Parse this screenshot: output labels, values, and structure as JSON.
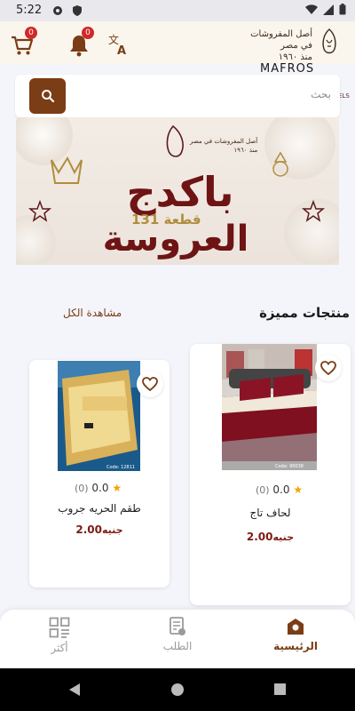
{
  "status_bar": {
    "time": "5:22"
  },
  "header": {
    "cart_badge": "0",
    "notifications_badge": "0",
    "logo_line1": "أصل المفروشات في مصر",
    "logo_line2": "منذ ١٩٦٠",
    "sub_brand": "MAFROS",
    "sub_brand2": "ELS"
  },
  "search": {
    "placeholder": "بحث"
  },
  "banner": {
    "title_line1": "باكدج",
    "title_line2": "العروسة",
    "pieces": "131 قطعة",
    "logo_line1": "أصل المفروشات في مصر",
    "logo_line2": "منذ ١٩٦٠"
  },
  "featured": {
    "title": "منتجات مميزة",
    "see_all": "مشاهدة الكل",
    "products": [
      {
        "name": "لحاف تاج",
        "rating": "0.0",
        "count": "(0)",
        "price": "2.00",
        "currency": "جنيه",
        "image_caption": "Code: 90038"
      },
      {
        "name": "طقم الحريه جروب",
        "rating": "0.0",
        "count": "(0)",
        "price": "2.00",
        "currency": "جنيه",
        "image_caption": "Code: 12811"
      }
    ]
  },
  "bottom_nav": {
    "home": "الرئيسية",
    "orders": "الطلب",
    "more": "أكثر"
  },
  "colors": {
    "accent": "#7a3d15",
    "price": "#7a1c14",
    "badge": "#d12828"
  }
}
